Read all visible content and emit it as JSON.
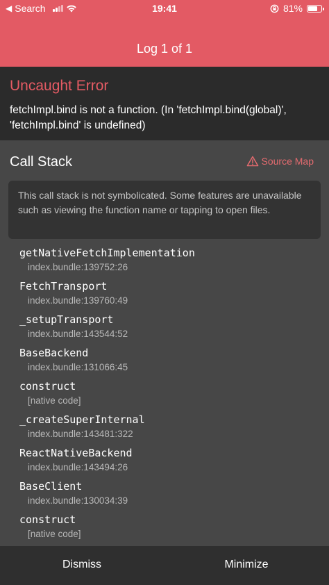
{
  "status_bar": {
    "back_label": "Search",
    "time": "19:41",
    "battery": "81%",
    "battery_level": 0.81
  },
  "header": {
    "title": "Log 1 of 1"
  },
  "error": {
    "title": "Uncaught Error",
    "message": "fetchImpl.bind is not a function. (In 'fetchImpl.bind(global)', 'fetchImpl.bind' is undefined)"
  },
  "call_stack": {
    "title": "Call Stack",
    "source_map_label": "Source Map",
    "note": "This call stack is not symbolicated. Some features are unavailable such as viewing the function name or tapping to open files.",
    "frames": [
      {
        "name": "getNativeFetchImplementation",
        "location": "index.bundle:139752:26"
      },
      {
        "name": "FetchTransport",
        "location": "index.bundle:139760:49"
      },
      {
        "name": "_setupTransport",
        "location": "index.bundle:143544:52"
      },
      {
        "name": "BaseBackend",
        "location": "index.bundle:131066:45"
      },
      {
        "name": "construct",
        "location": "[native code]"
      },
      {
        "name": "_createSuperInternal",
        "location": "index.bundle:143481:322"
      },
      {
        "name": "ReactNativeBackend",
        "location": "index.bundle:143494:26"
      },
      {
        "name": "BaseClient",
        "location": "index.bundle:130034:39"
      },
      {
        "name": "construct",
        "location": "[native code]"
      }
    ]
  },
  "footer": {
    "dismiss_label": "Dismiss",
    "minimize_label": "Minimize"
  },
  "colors": {
    "header_bg": "#E35A64",
    "error_title": "#E65B64",
    "source_map": "#E46B6F",
    "panel_bg": "#474747",
    "error_bg": "#2B2B2B",
    "footer_bg": "#2F2F2F"
  }
}
